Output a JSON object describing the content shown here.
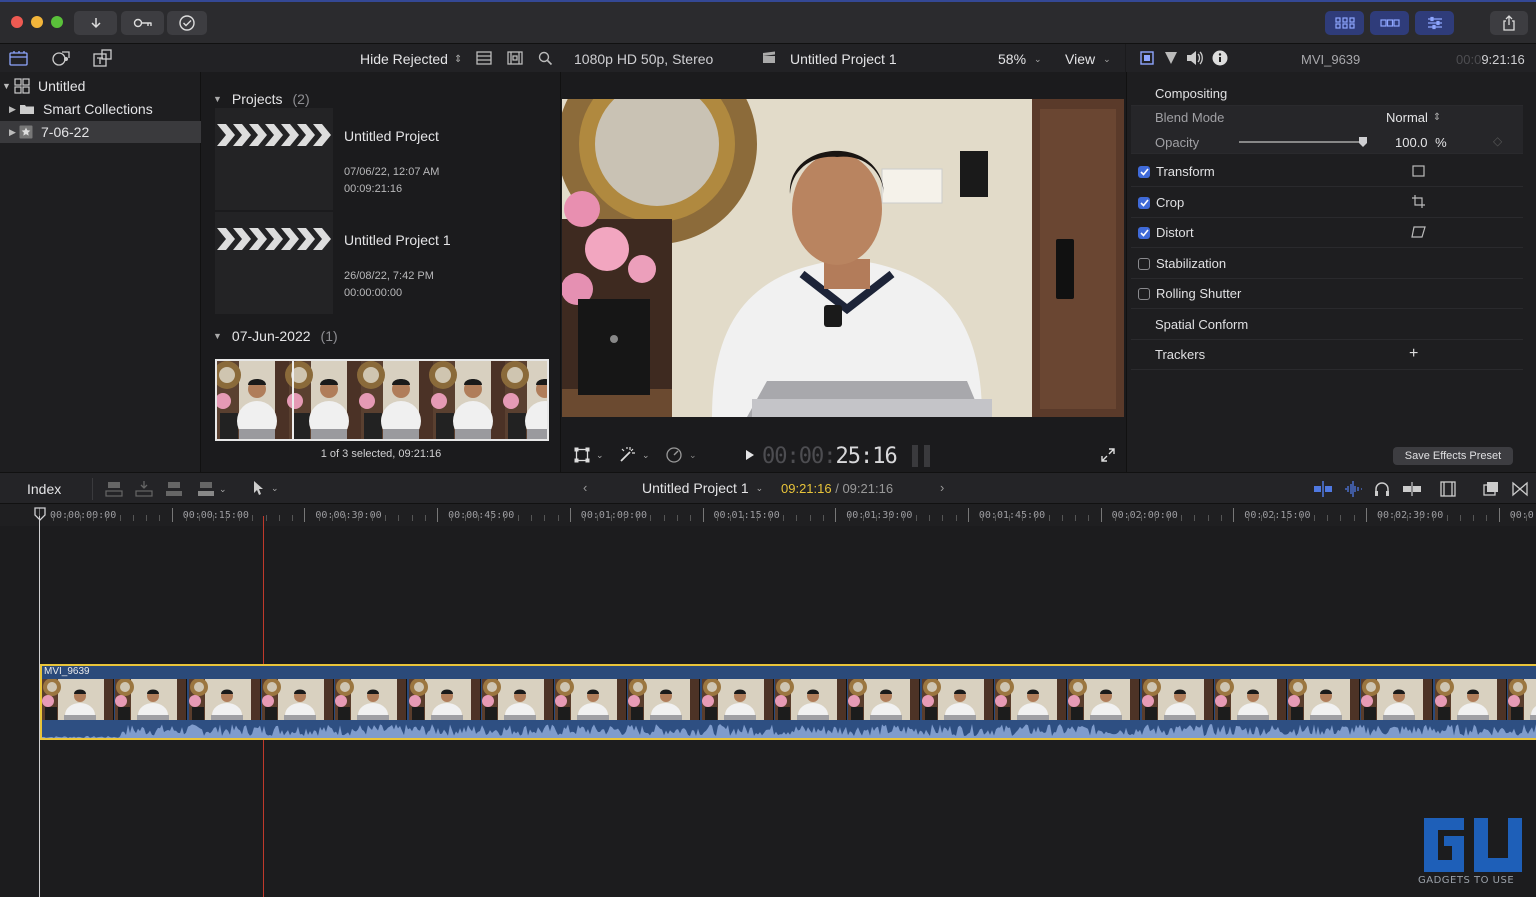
{
  "colors": {
    "accent": "#3f6ad8",
    "timecode_yellow": "#e8c43a",
    "playhead": "#c0392b",
    "clip_border": "#e8c43a",
    "audio_wave": "#6f8fc0"
  },
  "library": {
    "root": "Untitled",
    "items": [
      {
        "label": "Smart Collections",
        "icon": "folder-icon"
      },
      {
        "label": "7-06-22",
        "icon": "event-star-icon",
        "selected": true
      }
    ]
  },
  "browser": {
    "filter_label": "Hide Rejected",
    "projects_header": "Projects",
    "projects_count": "(2)",
    "projects": [
      {
        "name": "Untitled Project",
        "date": "07/06/22, 12:07 AM",
        "duration": "00:09:21:16"
      },
      {
        "name": "Untitled Project 1",
        "date": "26/08/22, 7:42 PM",
        "duration": "00:00:00:00"
      }
    ],
    "event_header": "07-Jun-2022",
    "event_count": "(1)",
    "status": "1 of 3 selected, 09:21:16"
  },
  "viewer": {
    "format": "1080p HD 50p, Stereo",
    "project": "Untitled Project 1",
    "zoom": "58%",
    "view_label": "View",
    "timecode_dim": "00:00:",
    "timecode_bright": "25:16"
  },
  "inspector": {
    "clip_name": "MVI_9639",
    "clip_tc_dim": "00:0",
    "clip_tc": "9:21:16",
    "compositing": "Compositing",
    "blend_mode_label": "Blend Mode",
    "blend_mode_value": "Normal",
    "opacity_label": "Opacity",
    "opacity_value": "100.0",
    "opacity_unit": "%",
    "opacity_level": 1.0,
    "rows": [
      {
        "label": "Transform",
        "checked": true,
        "icon": "transform-icon"
      },
      {
        "label": "Crop",
        "checked": true,
        "icon": "crop-icon"
      },
      {
        "label": "Distort",
        "checked": true,
        "icon": "distort-icon"
      },
      {
        "label": "Stabilization",
        "checked": false
      },
      {
        "label": "Rolling Shutter",
        "checked": false
      },
      {
        "label": "Spatial Conform",
        "checked": null
      },
      {
        "label": "Trackers",
        "checked": null,
        "icon": "plus-icon"
      }
    ],
    "save_preset": "Save Effects Preset"
  },
  "timeline": {
    "index_label": "Index",
    "project": "Untitled Project 1",
    "tc_current": "09:21:16",
    "tc_total": "09:21:16",
    "ruler": [
      "00:00:00:00",
      "00:00:15:00",
      "00:00:30:00",
      "00:00:45:00",
      "00:01:00:00",
      "00:01:15:00",
      "00:01:30:00",
      "00:01:45:00",
      "00:02:00:00",
      "00:02:15:00",
      "00:02:30:00",
      "00:0"
    ],
    "clip_name": "MVI_9639"
  },
  "watermark": "GADGETS TO USE"
}
